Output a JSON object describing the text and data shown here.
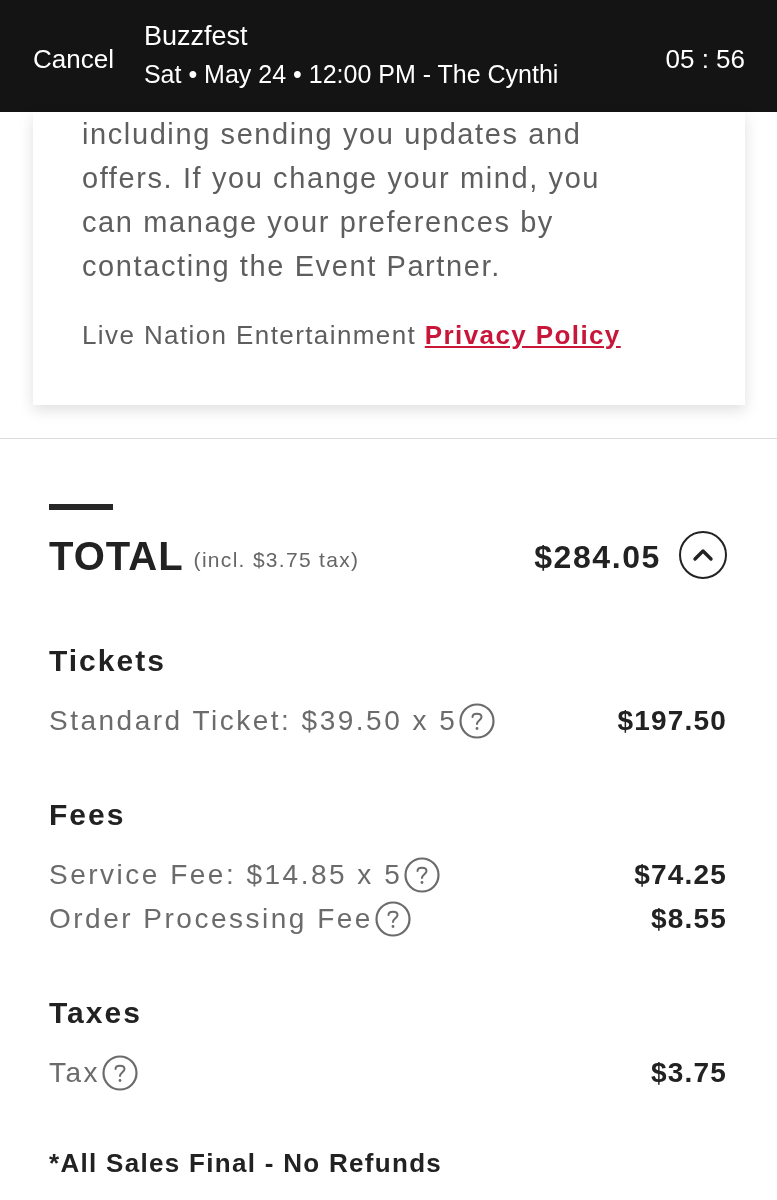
{
  "header": {
    "cancel": "Cancel",
    "title": "Buzzfest",
    "subtitle": "Sat • May 24 • 12:00 PM - The Cynthi",
    "timer": "05 : 56"
  },
  "consent_card": {
    "paragraph": "including sending you updates and offers. If you change your mind, you can manage your preferences by contacting the Event Partner.",
    "privacy": {
      "text": "Live Nation Entertainment",
      "link": "Privacy Policy"
    }
  },
  "total": {
    "label": "TOTAL",
    "note": "(incl. $3.75 tax)",
    "amount": "$284.05",
    "expanded": true
  },
  "sections": [
    {
      "title": "Tickets",
      "items": [
        {
          "label": "Standard Ticket: $39.50 x 5",
          "amount": "$197.50"
        }
      ]
    },
    {
      "title": "Fees",
      "items": [
        {
          "label": "Service Fee: $14.85 x 5",
          "amount": "$74.25"
        },
        {
          "label": "Order Processing Fee",
          "amount": "$8.55"
        }
      ]
    },
    {
      "title": "Taxes",
      "items": [
        {
          "label": "Tax",
          "amount": "$3.75"
        }
      ]
    }
  ],
  "footnote": "*All Sales Final - No Refunds"
}
